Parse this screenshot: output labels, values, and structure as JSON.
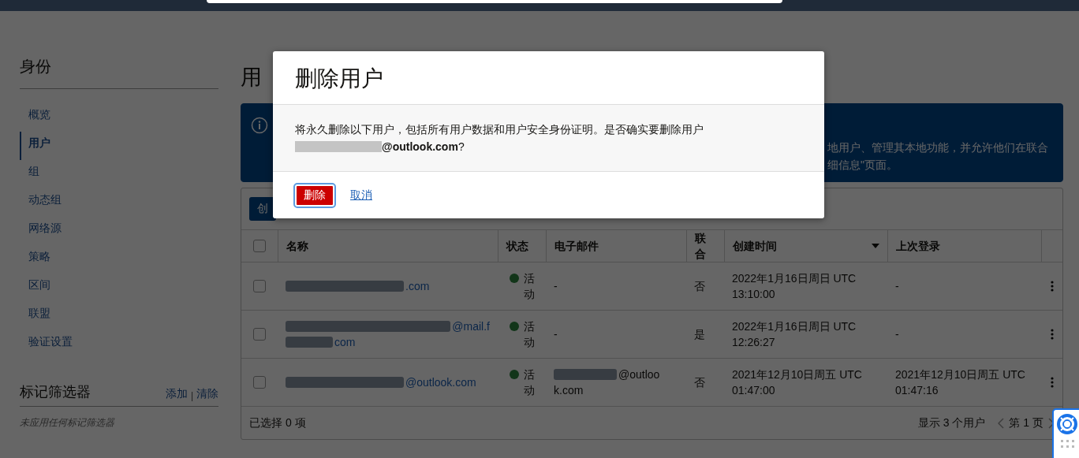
{
  "sidebar": {
    "title": "身份",
    "items": [
      {
        "label": "概览",
        "selected": false
      },
      {
        "label": "用户",
        "selected": true
      },
      {
        "label": "组",
        "selected": false
      },
      {
        "label": "动态组",
        "selected": false
      },
      {
        "label": "网络源",
        "selected": false
      },
      {
        "label": "策略",
        "selected": false
      },
      {
        "label": "区间",
        "selected": false
      },
      {
        "label": "联盟",
        "selected": false
      },
      {
        "label": "验证设置",
        "selected": false
      }
    ],
    "tag_filter": {
      "title": "标记筛选器",
      "add": "添加",
      "separator": "|",
      "clear": "清除",
      "empty": "未应用任何标记筛选器"
    }
  },
  "main": {
    "title": "用",
    "banner": {
      "lines": [
        "地用户、管理其本地功能，并允许他们在联合",
        "细信息\"页面。"
      ]
    },
    "create_button": "创",
    "table": {
      "columns": [
        {
          "label": "名称",
          "sorted": false
        },
        {
          "label": "状态",
          "sorted": false
        },
        {
          "label": "电子邮件",
          "sorted": false
        },
        {
          "label": "联合",
          "sorted": false
        },
        {
          "label": "创建时间",
          "sorted": true
        },
        {
          "label": "上次登录",
          "sorted": false
        }
      ],
      "header_checked": false,
      "rows": [
        {
          "checked": false,
          "name_lines": [
            ".com"
          ],
          "status": "活动",
          "email_lines": [
            "-"
          ],
          "federated": "否",
          "created": [
            "2022年1月16日周日 UTC",
            "13:10:00"
          ],
          "last_login": [
            "-"
          ]
        },
        {
          "checked": false,
          "name_lines": [
            "@mail.f",
            "com"
          ],
          "status": "活动",
          "email_lines": [
            "-"
          ],
          "federated": "是",
          "created": [
            "2022年1月16日周日 UTC",
            "12:26:27"
          ],
          "last_login": [
            "-"
          ]
        },
        {
          "checked": false,
          "name_lines": [
            "@outlook.com"
          ],
          "status": "活动",
          "email_lines": [
            "@outloo",
            "k.com"
          ],
          "federated": "否",
          "created": [
            "2021年12月10日周五 UTC",
            "01:47:00"
          ],
          "last_login": [
            "2021年12月10日周五 UTC",
            "01:47:16"
          ]
        }
      ],
      "selected_count": "已选择 0 项",
      "showing": "显示 3 个用户",
      "page": "第 1 页"
    }
  },
  "dialog": {
    "title": "删除用户",
    "message": "将永久删除以下用户，包括所有用户数据和用户安全身份证明。是否确实要删除用户",
    "target": "**@outlook.com**?",
    "confirm": "删除",
    "cancel": "取消"
  }
}
